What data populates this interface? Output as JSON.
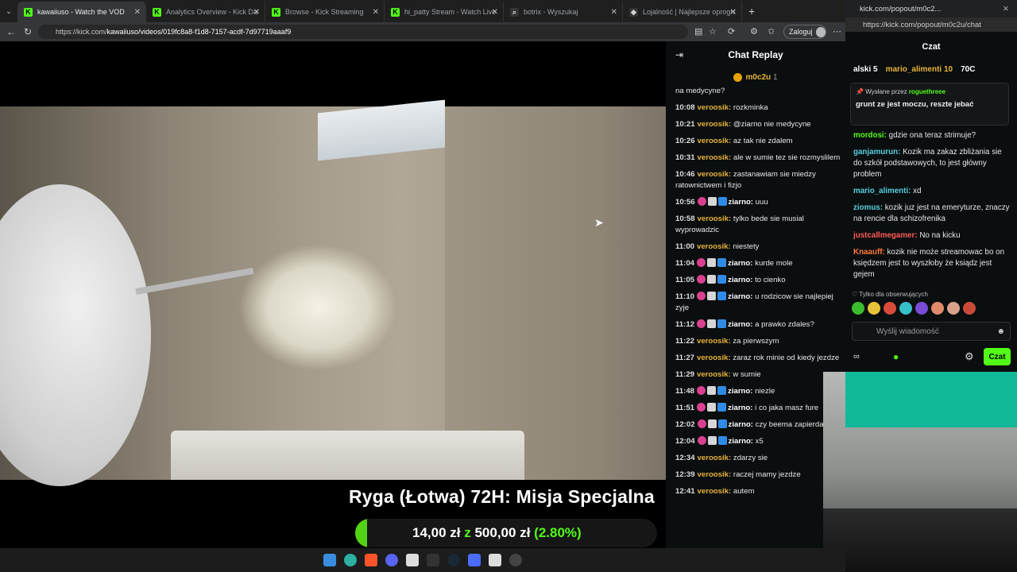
{
  "browser": {
    "tabs": [
      {
        "label": "kawaiiuso - Watch the VOD",
        "active": true,
        "fav": "K",
        "favcolor": "#53fc18"
      },
      {
        "label": "Analytics Overview - Kick Dashb",
        "active": false,
        "fav": "K",
        "favcolor": "#53fc18"
      },
      {
        "label": "Browse - Kick Streaming",
        "active": false,
        "fav": "K",
        "favcolor": "#53fc18"
      },
      {
        "label": "hi_patty Stream - Watch Live o",
        "active": false,
        "fav": "K",
        "favcolor": "#53fc18"
      },
      {
        "label": "botrix - Wyszukaj",
        "active": false,
        "fav": "⌕",
        "favcolor": "#333"
      },
      {
        "label": "Lojalność | Najlepsze oprogram",
        "active": false,
        "fav": "◈",
        "favcolor": "#333"
      }
    ],
    "url_host": "https://kick.com/",
    "url_path": "kawaiiuso/videos/019fc8a8-f1d8-7157-acdf-7d97719aaaf9",
    "login_label": "Zaloguj"
  },
  "stream_overlay": {
    "title": "Ryga (Łotwa) 72H: Misja Specjalna",
    "amount": "14,00 zł",
    "separator": "z",
    "goal": "500,00 zł",
    "percent": "(2.80%)",
    "progress": 0.028
  },
  "chat_replay": {
    "title": "Chat Replay",
    "pinned_user": "m0c2u",
    "pinned_count": "1",
    "messages": [
      {
        "time": "",
        "user": "",
        "text": "na medycyne?",
        "badges": false,
        "color": "vu"
      },
      {
        "time": "10:08",
        "user": "veroosik:",
        "text": "rozkminka",
        "badges": false,
        "color": "vu"
      },
      {
        "time": "10:21",
        "user": "veroosik:",
        "text": "@ziarno nie medycyne",
        "badges": false,
        "color": "vu"
      },
      {
        "time": "10:26",
        "user": "veroosik:",
        "text": "az tak nie zdalem",
        "badges": false,
        "color": "vu"
      },
      {
        "time": "10:31",
        "user": "veroosik:",
        "text": "ale w sumie tez sie rozmyslilem",
        "badges": false,
        "color": "vu"
      },
      {
        "time": "10:46",
        "user": "veroosik:",
        "text": "zastanawiam sie miedzy ratownictwem i fizjo",
        "badges": false,
        "color": "vu"
      },
      {
        "time": "10:56",
        "user": "ziarno:",
        "text": "uuu",
        "badges": true,
        "color": "zu"
      },
      {
        "time": "10:58",
        "user": "veroosik:",
        "text": "tylko bede sie musial wyprowadzic",
        "badges": false,
        "color": "vu"
      },
      {
        "time": "11:00",
        "user": "veroosik:",
        "text": "niestety",
        "badges": false,
        "color": "vu"
      },
      {
        "time": "11:04",
        "user": "ziarno:",
        "text": "kurde mole",
        "badges": true,
        "color": "zu"
      },
      {
        "time": "11:05",
        "user": "ziarno:",
        "text": "to cienko",
        "badges": true,
        "color": "zu"
      },
      {
        "time": "11:10",
        "user": "ziarno:",
        "text": "u rodzicow sie najlepiej zyje",
        "badges": true,
        "color": "zu"
      },
      {
        "time": "11:12",
        "user": "ziarno:",
        "text": "a prawko zdales?",
        "badges": true,
        "color": "zu"
      },
      {
        "time": "11:22",
        "user": "veroosik:",
        "text": "za pierwszym",
        "badges": false,
        "color": "vu"
      },
      {
        "time": "11:27",
        "user": "veroosik:",
        "text": "zaraz rok minie od kiedy jezdze",
        "badges": false,
        "color": "vu"
      },
      {
        "time": "11:29",
        "user": "veroosik:",
        "text": "w sumie",
        "badges": false,
        "color": "vu"
      },
      {
        "time": "11:48",
        "user": "ziarno:",
        "text": "niezle",
        "badges": true,
        "color": "zu"
      },
      {
        "time": "11:51",
        "user": "ziarno:",
        "text": "i co jaka masz fure",
        "badges": true,
        "color": "zu"
      },
      {
        "time": "12:02",
        "user": "ziarno:",
        "text": "czy beema zapierdalasz",
        "badges": true,
        "color": "zu"
      },
      {
        "time": "12:04",
        "user": "ziarno:",
        "text": "x5",
        "badges": true,
        "color": "zu"
      },
      {
        "time": "12:34",
        "user": "veroosik:",
        "text": "zdarzy sie",
        "badges": false,
        "color": "vu"
      },
      {
        "time": "12:39",
        "user": "veroosik:",
        "text": "raczej mamy jezdze",
        "badges": false,
        "color": "vu"
      },
      {
        "time": "12:41",
        "user": "veroosik:",
        "text": "autem",
        "badges": false,
        "color": "vu"
      }
    ]
  },
  "popout": {
    "window_title": "kick.com/popout/m0c2...",
    "url": "https://kick.com/popout/m0c2u/chat",
    "header": "Czat",
    "leaderboard": [
      "alski 5",
      "mario_alimenti 10",
      "70C"
    ],
    "pinned_by_label": "Wysłane przez",
    "pinned_by_user": "roguethreee",
    "pinned_text": "grunt ze jest moczu, reszte jebać",
    "messages": [
      {
        "user": "mordosi:",
        "text": "gdzie ona teraz strimuje?",
        "color": "#53fc18"
      },
      {
        "user": "ganjamurun:",
        "text": "Kozik ma zakaz zbliżania sie do szkół podstawowych, to jest główny problem",
        "color": "#56d0e0"
      },
      {
        "user": "mario_alimenti:",
        "text": "xd",
        "color": "#56d0e0"
      },
      {
        "user": "ziomus:",
        "text": "kozik juz jest na emeryturze, znaczy na rencie dla schizofrenika",
        "color": "#56d0e0"
      },
      {
        "user": "justcallmegamer:",
        "text": "No na kicku",
        "color": "#ff5a5a"
      },
      {
        "user": "Knaauff:",
        "text": "kozik nie może streamowac bo on księdzem jest to wyszłoby że ksiądz jest gejem",
        "color": "#ff7a3a"
      }
    ],
    "followers_only": "Tylko dla obserwujących",
    "send_placeholder": "Wyślij wiadomość",
    "chat_button": "Czat"
  }
}
